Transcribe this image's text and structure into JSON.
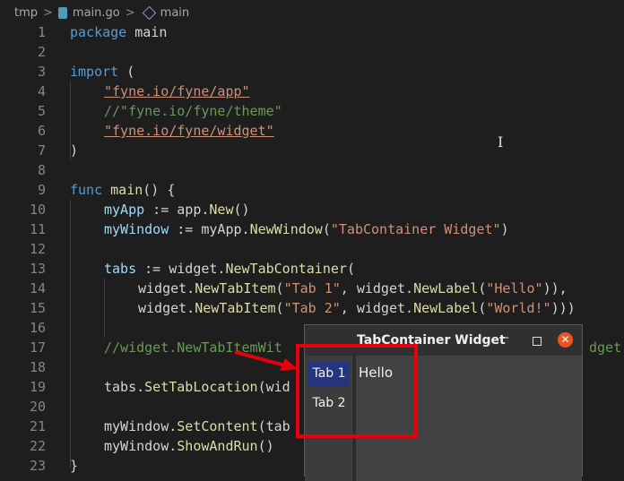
{
  "breadcrumb": {
    "folder": "tmp",
    "file": "main.go",
    "symbol": "main"
  },
  "editor": {
    "lines": [
      {
        "n": "1"
      },
      {
        "n": "2"
      },
      {
        "n": "3"
      },
      {
        "n": "4"
      },
      {
        "n": "5"
      },
      {
        "n": "6"
      },
      {
        "n": "7"
      },
      {
        "n": "8"
      },
      {
        "n": "9"
      },
      {
        "n": "10"
      },
      {
        "n": "11"
      },
      {
        "n": "12"
      },
      {
        "n": "13"
      },
      {
        "n": "14"
      },
      {
        "n": "15"
      },
      {
        "n": "16"
      },
      {
        "n": "17"
      },
      {
        "n": "18"
      },
      {
        "n": "19"
      },
      {
        "n": "20"
      },
      {
        "n": "21"
      },
      {
        "n": "22"
      },
      {
        "n": "23"
      }
    ],
    "code": {
      "l1_kw": "package",
      "l1_rest": " main",
      "l3_kw": "import",
      "l3_rest": " (",
      "l4": "\"fyne.io/fyne/app\"",
      "l5": "//\"fyne.io/fyne/theme\"",
      "l6": "\"fyne.io/fyne/widget\"",
      "l7": ")",
      "l9_kw": "func",
      "l9_fn": " main",
      "l9_rest": "() {",
      "l10_var": "myApp",
      "l10_a": " := app.",
      "l10_fn": "New",
      "l10_b": "()",
      "l11_var": "myWindow",
      "l11_a": " := myApp.",
      "l11_fn": "NewWindow",
      "l11_b": "(",
      "l11_str": "\"TabContainer Widget\"",
      "l11_c": ")",
      "l13_var": "tabs",
      "l13_a": " := widget.",
      "l13_fn": "NewTabContainer",
      "l13_b": "(",
      "l14_a": "widget.",
      "l14_fn": "NewTabItem",
      "l14_b": "(",
      "l14_s1": "\"Tab 1\"",
      "l14_c": ", widget.",
      "l14_fn2": "NewLabel",
      "l14_d": "(",
      "l14_s2": "\"Hello\"",
      "l14_e": ")),",
      "l15_a": "widget.",
      "l15_fn": "NewTabItem",
      "l15_b": "(",
      "l15_s1": "\"Tab 2\"",
      "l15_c": ", widget.",
      "l15_fn2": "NewLabel",
      "l15_d": "(",
      "l15_s2": "\"World!\"",
      "l15_e": ")))",
      "l17": "//widget.NewTabItemWit",
      "l17_tail": "dget",
      "l19_a": "tabs.",
      "l19_fn": "SetTabLocation",
      "l19_b": "(wid",
      "l21_a": "myWindow.",
      "l21_fn": "SetContent",
      "l21_b": "(tab",
      "l22_a": "myWindow.",
      "l22_fn": "ShowAndRun",
      "l22_b": "()",
      "l23": "}"
    }
  },
  "app_window": {
    "title": "TabContainer Widget",
    "minimize": "–",
    "close": "✕",
    "tabs": [
      {
        "label": "Tab 1",
        "active": true
      },
      {
        "label": "Tab 2",
        "active": false
      }
    ],
    "content_label": "Hello"
  },
  "colors": {
    "active_tab": "#26367e",
    "close_button": "#e95420",
    "annotation": "#e8000b"
  }
}
